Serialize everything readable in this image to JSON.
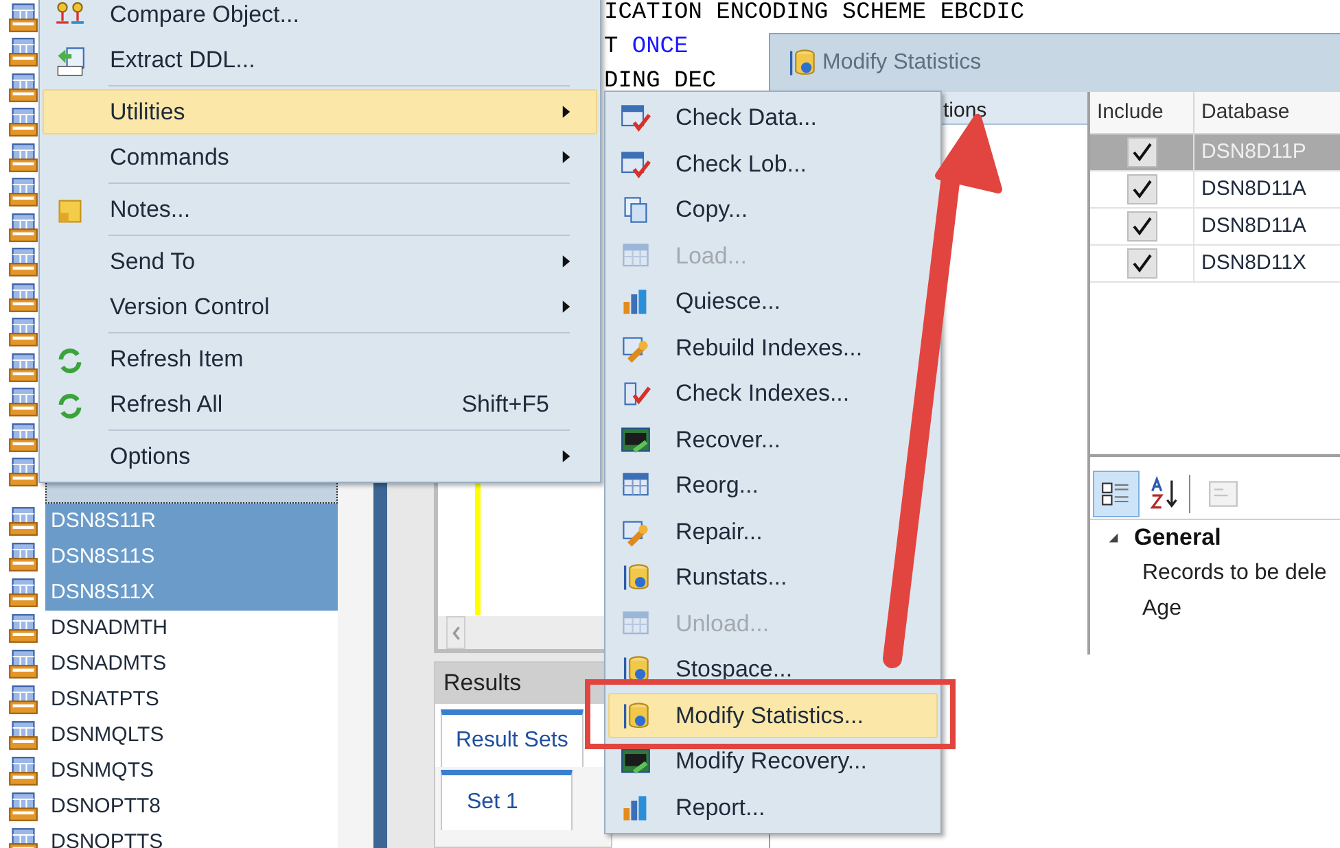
{
  "code_lines": [
    [
      {
        "text": "ICATION ENCODING SCHEME EBCDIC",
        "kind": "plain"
      }
    ],
    [
      {
        "text": "T ",
        "kind": "plain"
      },
      {
        "text": "ONCE",
        "kind": "keyword"
      }
    ],
    [
      {
        "text": "DING DEC",
        "kind": "plain"
      }
    ]
  ],
  "tree": {
    "rows": [
      {
        "label": "DSN8S11R",
        "selected": true
      },
      {
        "label": "DSN8S11S",
        "selected": true
      },
      {
        "label": "DSN8S11X",
        "selected": true
      },
      {
        "label": "DSNADMTH",
        "selected": false
      },
      {
        "label": "DSNADMTS",
        "selected": false
      },
      {
        "label": "DSNATPTS",
        "selected": false
      },
      {
        "label": "DSNMQLTS",
        "selected": false
      },
      {
        "label": "DSNMQTS",
        "selected": false
      },
      {
        "label": "DSNOPTT8",
        "selected": false
      },
      {
        "label": "DSNOPTTS",
        "selected": false
      }
    ]
  },
  "context_menu": {
    "items": [
      {
        "kind": "item",
        "label": "Compare Object...",
        "submenu": false,
        "selected": false
      },
      {
        "kind": "item",
        "label": "Extract DDL...",
        "submenu": false,
        "selected": false
      },
      {
        "kind": "separator"
      },
      {
        "kind": "item",
        "label": "Utilities",
        "submenu": true,
        "selected": true
      },
      {
        "kind": "item",
        "label": "Commands",
        "submenu": true,
        "selected": false
      },
      {
        "kind": "separator"
      },
      {
        "kind": "item",
        "label": "Notes...",
        "submenu": false,
        "selected": false
      },
      {
        "kind": "separator"
      },
      {
        "kind": "item",
        "label": "Send To",
        "submenu": true,
        "selected": false
      },
      {
        "kind": "item",
        "label": "Version Control",
        "submenu": true,
        "selected": false
      },
      {
        "kind": "separator"
      },
      {
        "kind": "item",
        "label": "Refresh Item",
        "submenu": false,
        "selected": false
      },
      {
        "kind": "item",
        "label": "Refresh All",
        "submenu": false,
        "selected": false,
        "shortcut": "Shift+F5"
      },
      {
        "kind": "separator"
      },
      {
        "kind": "item",
        "label": "Options",
        "submenu": true,
        "selected": false
      }
    ]
  },
  "utilities_menu": {
    "items": [
      {
        "label": "Check Data...",
        "disabled": false,
        "selected": false
      },
      {
        "label": "Check Lob...",
        "disabled": false,
        "selected": false
      },
      {
        "label": "Copy...",
        "disabled": false,
        "selected": false
      },
      {
        "label": "Load...",
        "disabled": true,
        "selected": false
      },
      {
        "label": "Quiesce...",
        "disabled": false,
        "selected": false
      },
      {
        "label": "Rebuild Indexes...",
        "disabled": false,
        "selected": false
      },
      {
        "label": "Check Indexes...",
        "disabled": false,
        "selected": false
      },
      {
        "label": "Recover...",
        "disabled": false,
        "selected": false
      },
      {
        "label": "Reorg...",
        "disabled": false,
        "selected": false
      },
      {
        "label": "Repair...",
        "disabled": false,
        "selected": false
      },
      {
        "label": "Runstats...",
        "disabled": false,
        "selected": false
      },
      {
        "label": "Unload...",
        "disabled": true,
        "selected": false
      },
      {
        "label": "Stospace...",
        "disabled": false,
        "selected": false
      },
      {
        "label": "Modify Statistics...",
        "disabled": false,
        "selected": true
      },
      {
        "label": "Modify Recovery...",
        "disabled": false,
        "selected": false
      },
      {
        "label": "Report...",
        "disabled": false,
        "selected": false
      }
    ]
  },
  "results": {
    "title": "Results",
    "tabs": [
      {
        "label": "Result Sets",
        "selected": true
      }
    ],
    "subtabs": [
      {
        "label": "Set 1",
        "selected": true
      }
    ]
  },
  "dialog": {
    "title": "Modify Statistics",
    "tab_label": "tions",
    "grid": {
      "columns": [
        "Include",
        "Database"
      ],
      "rows": [
        {
          "include": true,
          "database": "DSN8D11P",
          "selected": true
        },
        {
          "include": true,
          "database": "DSN8D11A",
          "selected": false
        },
        {
          "include": true,
          "database": "DSN8D11A",
          "selected": false
        },
        {
          "include": true,
          "database": "DSN8D11X",
          "selected": false
        }
      ]
    },
    "properties": {
      "categorized": true,
      "category": "General",
      "expanded": true,
      "rows": [
        "Records to be dele",
        "Age"
      ]
    }
  }
}
